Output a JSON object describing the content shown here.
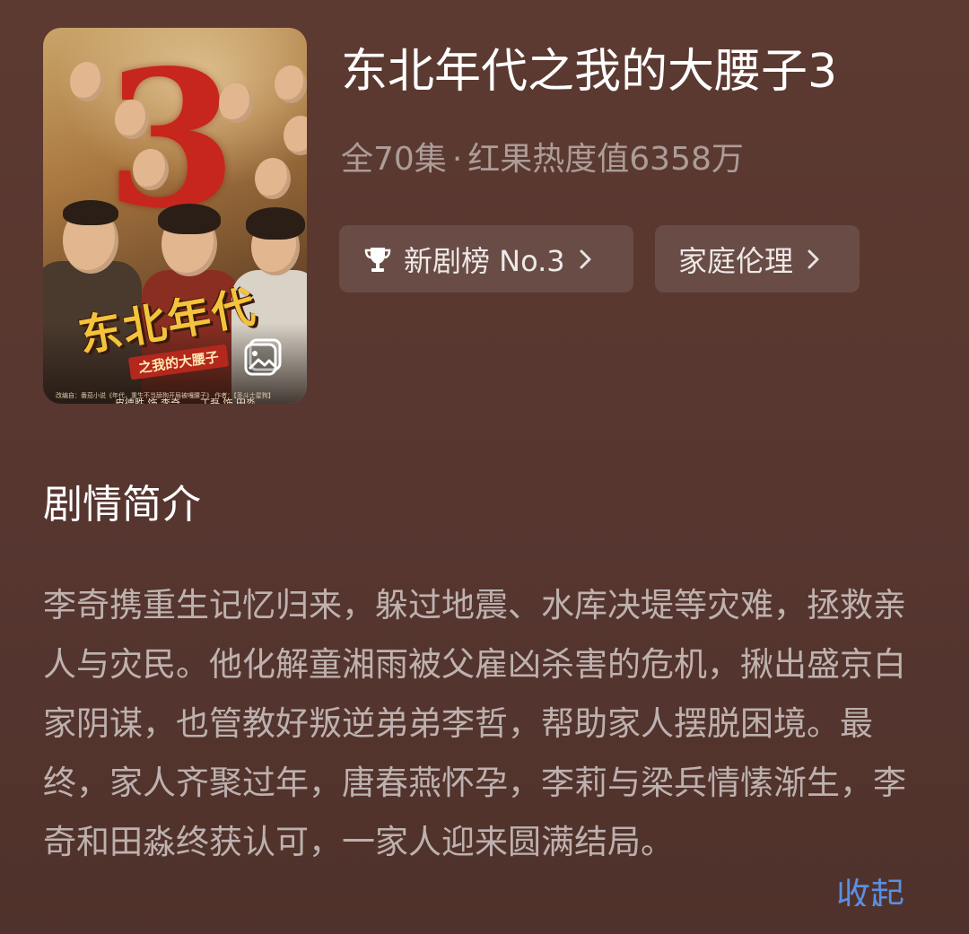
{
  "drama": {
    "title": "东北年代之我的大腰子3",
    "episodes": "全70集",
    "separator": "·",
    "heat": "红果热度值6358万"
  },
  "poster": {
    "big_number": "3",
    "art_title": "东北年代",
    "art_subtitle": "之我的大腰子",
    "cast": "皮德胜 饰 李奇　　丁磊 饰 田淼",
    "credit": "改编自：番茄小说《年代，重生不当舔狗开局被嘎腰子》 作者：【圣斗士星狗】",
    "gallery_icon": "gallery-icon"
  },
  "chips": [
    {
      "label": "新剧榜 No.3",
      "icon": "trophy-icon"
    },
    {
      "label": "家庭伦理",
      "icon": ""
    }
  ],
  "synopsis": {
    "heading": "剧情简介",
    "text": "李奇携重生记忆归来，躲过地震、水库决堤等灾难，拯救亲人与灾民。他化解童湘雨被父雇凶杀害的危机，揪出盛京白家阴谋，也管教好叛逆弟弟李哲，帮助家人摆脱困境。最终，家人齐聚过年，唐春燕怀孕，李莉与梁兵情愫渐生，李奇和田淼终获认可，一家人迎来圆满结局。",
    "collapse_label": "收起"
  },
  "colors": {
    "background": "#573630",
    "link": "#5b8fe3",
    "chip_bg": "rgba(255,255,255,0.1)"
  }
}
